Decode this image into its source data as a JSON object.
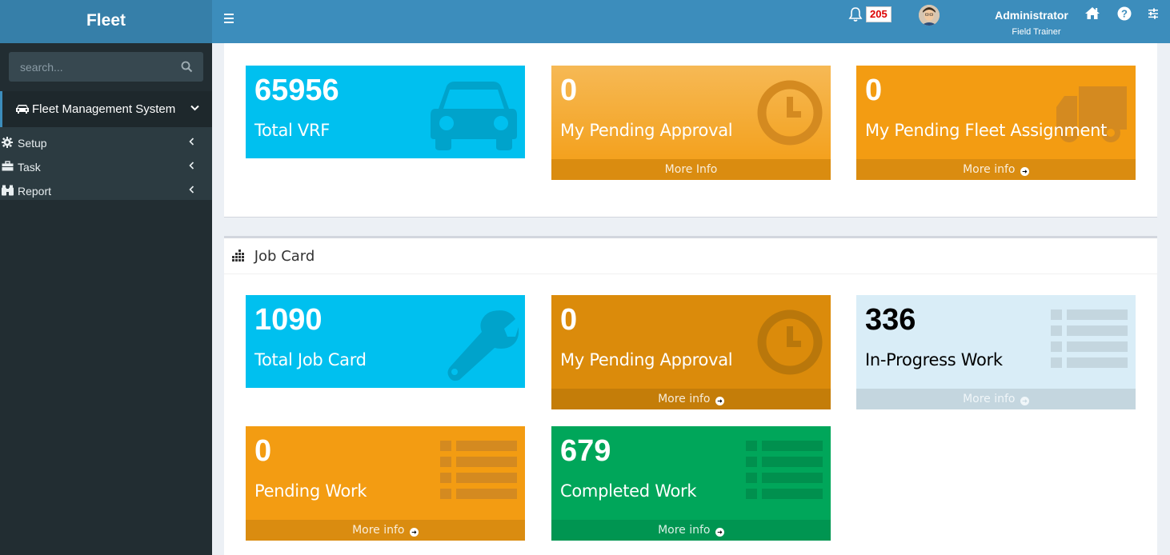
{
  "app": {
    "title": "Fleet"
  },
  "header": {
    "notifications_count": "205",
    "user_name": "Administrator",
    "user_role": "Field Trainer"
  },
  "sidebar": {
    "search_placeholder": "search...",
    "main_menu": "Fleet Management System",
    "items": [
      {
        "label": "Setup",
        "icon": "gear-icon"
      },
      {
        "label": "Task",
        "icon": "briefcase-icon"
      },
      {
        "label": "Report",
        "icon": "binoculars-icon"
      }
    ]
  },
  "vrf": {
    "tiles": [
      {
        "value": "65956",
        "label": "Total VRF",
        "footer": "",
        "icon": "car-icon",
        "color": "#00c0ef"
      },
      {
        "value": "0",
        "label": "My Pending Approval",
        "footer": "More Info",
        "icon": "clock-icon",
        "color": "#f39c12"
      },
      {
        "value": "0",
        "label": "My Pending Fleet Assignment",
        "footer": "More info",
        "icon": "truck-icon",
        "color": "#f39c12"
      }
    ]
  },
  "job_card": {
    "title": "Job Card",
    "tiles": [
      {
        "value": "1090",
        "label": "Total Job Card",
        "footer": "",
        "icon": "wrench-icon",
        "color": "#00c0ef"
      },
      {
        "value": "0",
        "label": "My Pending Approval",
        "footer": "More info",
        "icon": "clock-icon",
        "color": "#db8b0b"
      },
      {
        "value": "336",
        "label": "In-Progress Work",
        "footer": "More info",
        "icon": "list-icon",
        "color": "#d9edf7"
      },
      {
        "value": "0",
        "label": "Pending Work",
        "footer": "More info",
        "icon": "list-icon",
        "color": "#f39c12"
      },
      {
        "value": "679",
        "label": "Completed Work",
        "footer": "More info",
        "icon": "list-icon",
        "color": "#00a65a"
      }
    ]
  }
}
